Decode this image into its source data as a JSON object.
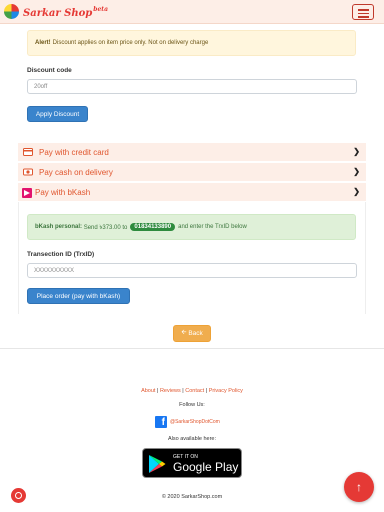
{
  "header": {
    "brand": "Sarkar Shop",
    "brand_sup": "beta",
    "menu_icon": "hamburger-icon",
    "colors": {
      "brand": "#e53935",
      "navbar_bg": "#fdeee7"
    }
  },
  "alert": {
    "strong": "Alert!",
    "text": "Discount applies on item price only. Not on delivery charge"
  },
  "discount": {
    "label": "Discount code",
    "value": "20off",
    "apply_button": "Apply Discount"
  },
  "payment_methods": [
    {
      "label": "Pay with credit card",
      "icon": "credit-card-icon"
    },
    {
      "label": "Pay cash on delivery",
      "icon": "cash-icon"
    },
    {
      "label": "Pay with bKash",
      "icon": "bkash-icon"
    }
  ],
  "bkash": {
    "strong": "bKash personal:",
    "send_text": "Send ৳373.00 to",
    "number": "01834133890",
    "after_text": "and enter the TrxID below",
    "trx_label": "Transection ID (TrxID)",
    "trx_placeholder": "XXXXXXXXXX",
    "place_order_button": "Place order (pay with bKash)"
  },
  "back_button": {
    "icon": "arrow-left-icon",
    "label": "Back"
  },
  "footer": {
    "links": [
      "About",
      "Reviews",
      "Contact",
      "Privacy Policy"
    ],
    "follow_us": "Follow Us:",
    "facebook_handle": "@SarkarShopDotCom",
    "also_available": "Also available here:",
    "gplay_small": "GET IT ON",
    "gplay_big": "Google Play",
    "copyright": "© 2020 SarkarShop.com"
  },
  "floating": {
    "chat_icon": "chat-icon",
    "scroll_top_icon": "arrow-up-icon"
  }
}
